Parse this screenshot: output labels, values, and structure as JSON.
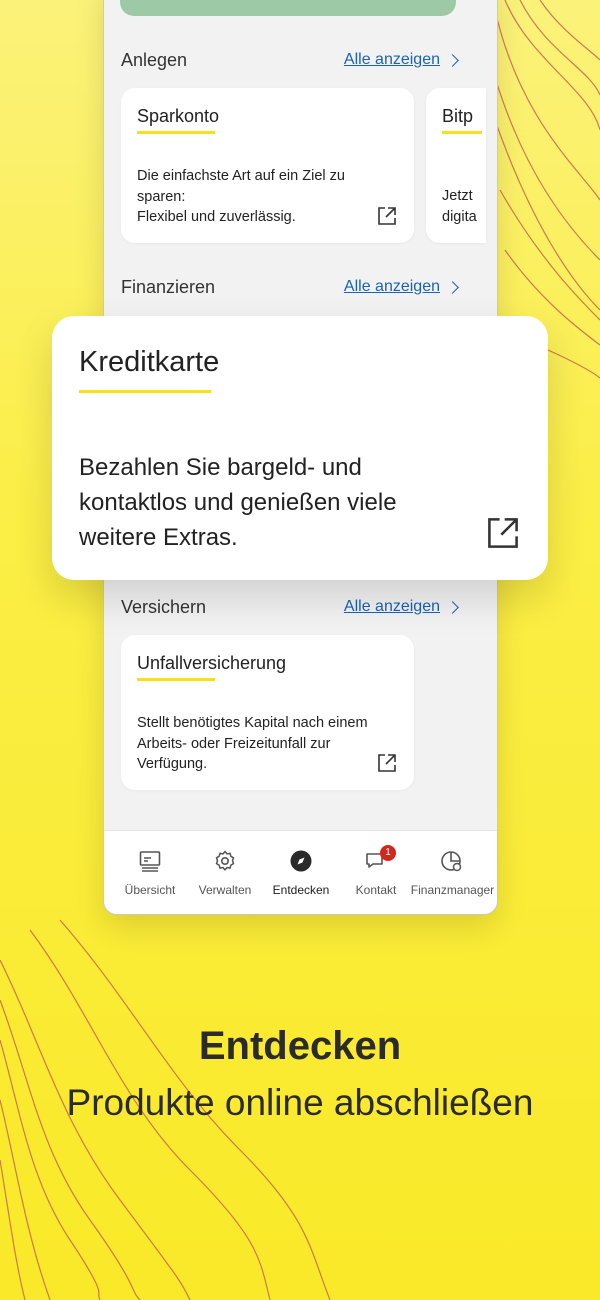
{
  "sections": {
    "anlegen": {
      "title": "Anlegen",
      "show_all": "Alle anzeigen",
      "cards": [
        {
          "title": "Sparkonto",
          "desc_lines": [
            "Die einfachste Art auf ein Ziel zu",
            "sparen:",
            "Flexibel und zuverlässig."
          ]
        },
        {
          "title": "Bitp",
          "desc_lines": [
            "Jetzt",
            "digita"
          ]
        }
      ]
    },
    "finanzieren": {
      "title": "Finanzieren",
      "show_all": "Alle anzeigen"
    },
    "versichern": {
      "title": "Versichern",
      "show_all": "Alle anzeigen",
      "cards": [
        {
          "title": "Unfallversicherung",
          "desc_lines": [
            "Stellt benötigtes Kapital nach einem",
            "Arbeits- oder Freizeitunfall zur",
            "Verfügung."
          ]
        }
      ]
    }
  },
  "featured_card": {
    "title": "Kreditkarte",
    "desc_lines": [
      "Bezahlen Sie bargeld- und",
      "kontaktlos und genießen viele",
      "weitere Extras."
    ]
  },
  "bottom_nav": {
    "items": [
      {
        "label": "Übersicht",
        "icon": "overview-icon"
      },
      {
        "label": "Verwalten",
        "icon": "gear-icon"
      },
      {
        "label": "Entdecken",
        "icon": "compass-icon",
        "active": true
      },
      {
        "label": "Kontakt",
        "icon": "chat-icon",
        "badge": "1"
      },
      {
        "label": "Finanzmanager",
        "icon": "finance-manager-icon"
      }
    ]
  },
  "promo": {
    "headline": "Entdecken",
    "subline": "Produkte online abschließen"
  },
  "colors": {
    "accent_yellow": "#f7e11b",
    "link_blue": "#1a63b8",
    "banner_green": "#9ec9a6",
    "badge_red": "#d3261d"
  }
}
